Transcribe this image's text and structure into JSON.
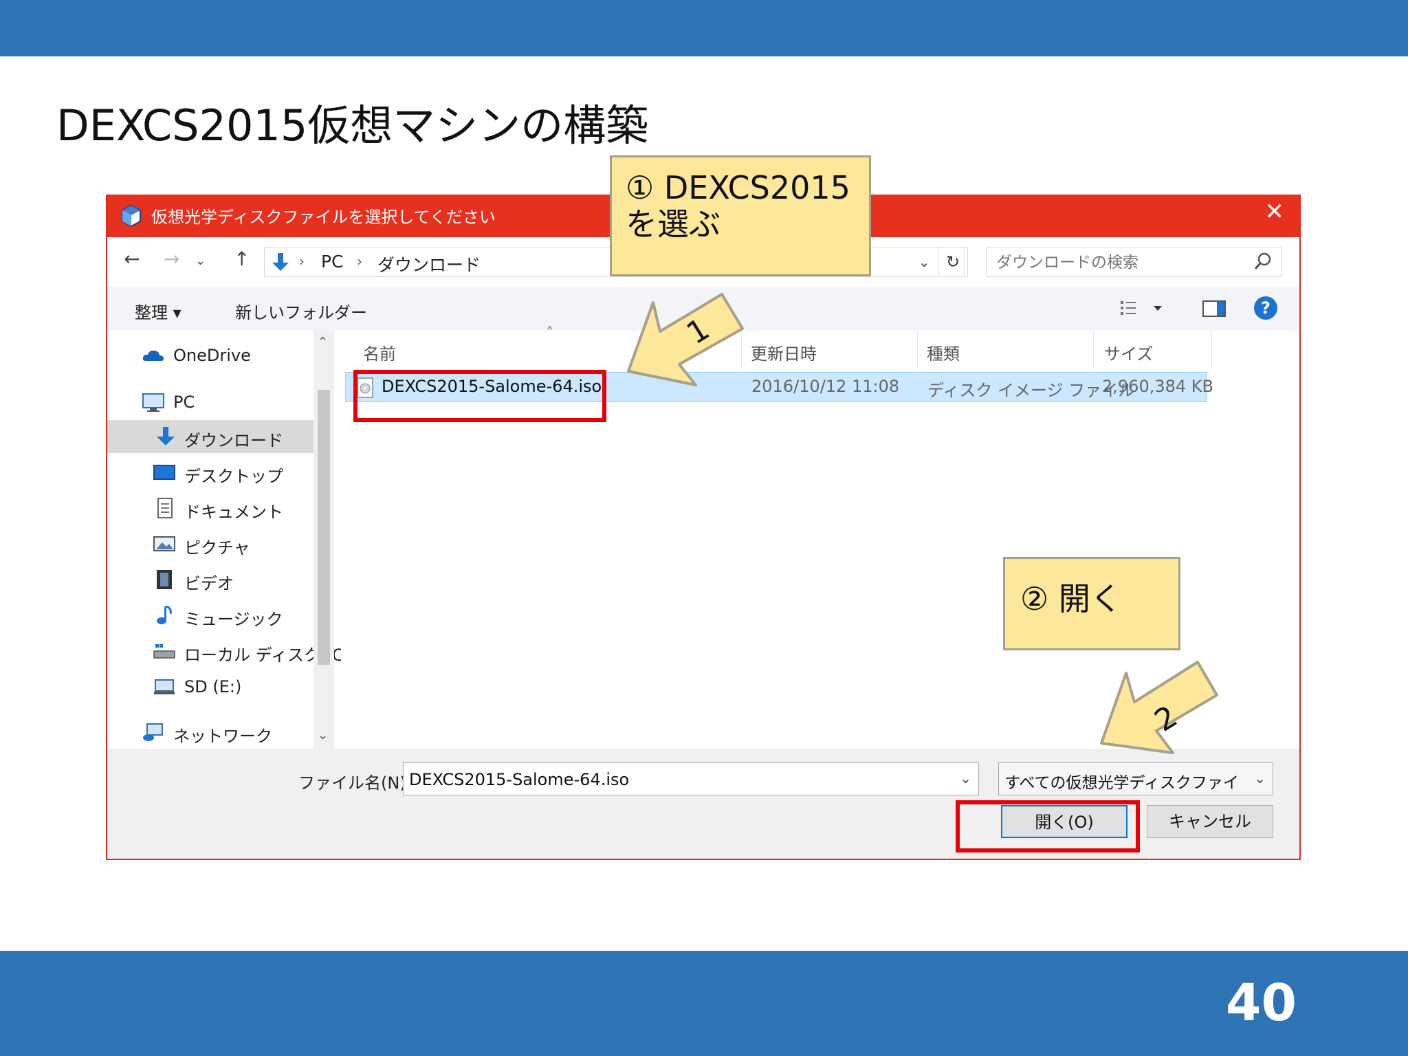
{
  "slide": {
    "title": "DEXCS2015仮想マシンの構築",
    "page_number": "40",
    "colors": {
      "band": "#2e74b5",
      "highlight": "#e8000b",
      "callout_fill": "#fce79b"
    }
  },
  "dialog": {
    "title": "仮想光学ディスクファイルを選択してください",
    "title_icon": "virtualbox-icon",
    "close_icon": "close-icon",
    "nav": {
      "back_icon": "back-arrow-icon",
      "forward_icon": "forward-arrow-icon",
      "recent_icon": "chevron-down-icon",
      "up_icon": "up-arrow-icon",
      "breadcrumb": [
        "PC",
        "ダウンロード"
      ],
      "refresh_icon": "refresh-icon",
      "search_placeholder": "ダウンロードの検索"
    },
    "toolbar": {
      "organize": "整理 ▾",
      "new_folder": "新しいフォルダー",
      "view_icon": "view-options-icon",
      "preview_icon": "preview-pane-icon",
      "help_icon": "help-icon",
      "help_glyph": "?"
    },
    "sidebar": {
      "items": [
        {
          "label": "OneDrive",
          "icon": "cloud-icon"
        },
        {
          "label": "PC",
          "icon": "computer-icon"
        },
        {
          "label": "ダウンロード",
          "icon": "download-icon",
          "selected": true
        },
        {
          "label": "デスクトップ",
          "icon": "desktop-icon"
        },
        {
          "label": "ドキュメント",
          "icon": "document-icon"
        },
        {
          "label": "ピクチャ",
          "icon": "picture-icon"
        },
        {
          "label": "ビデオ",
          "icon": "video-icon"
        },
        {
          "label": "ミュージック",
          "icon": "music-icon"
        },
        {
          "label": "ローカル ディスク (C",
          "icon": "drive-icon"
        },
        {
          "label": "SD (E:)",
          "icon": "sd-drive-icon"
        },
        {
          "label": "ネットワーク",
          "icon": "network-icon"
        }
      ]
    },
    "columns": [
      "名前",
      "更新日時",
      "種類",
      "サイズ"
    ],
    "files": [
      {
        "name": "DEXCS2015-Salome-64.iso",
        "modified": "2016/10/12 11:08",
        "type": "ディスク イメージ ファイル",
        "size": "2,960,384 KB"
      }
    ],
    "footer": {
      "filename_label": "ファイル名(N):",
      "filename_value": "DEXCS2015-Salome-64.iso",
      "filter": "すべての仮想光学ディスクファイル (*",
      "open_button": "開く(O)",
      "cancel_button": "キャンセル"
    }
  },
  "annotations": {
    "callout1": "① DEXCS2015\nを選ぶ",
    "callout2": "② 開く",
    "arrow1_label": "1",
    "arrow2_label": "2"
  }
}
